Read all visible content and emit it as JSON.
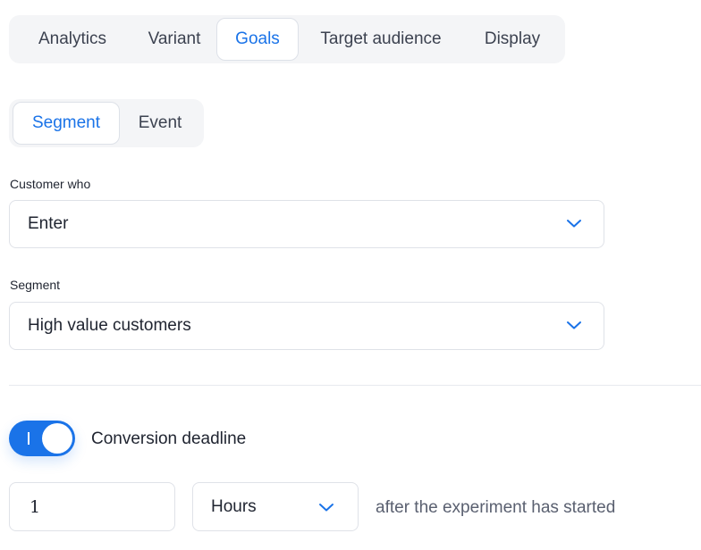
{
  "tabs": {
    "items": [
      {
        "label": "Analytics"
      },
      {
        "label": "Variant"
      },
      {
        "label": "Goals"
      },
      {
        "label": "Target audience"
      },
      {
        "label": "Display"
      }
    ],
    "active": "Goals"
  },
  "goal_type": {
    "options": [
      {
        "label": "Segment"
      },
      {
        "label": "Event"
      }
    ],
    "active": "Segment"
  },
  "customer_who": {
    "label": "Customer who",
    "value": "Enter"
  },
  "segment": {
    "label": "Segment",
    "value": "High value customers"
  },
  "conversion": {
    "toggle_on": true,
    "label": "Conversion deadline",
    "amount": "1",
    "unit": "Hours",
    "suffix": "after the experiment has started"
  },
  "colors": {
    "accent": "#1a73e8",
    "tab_bg": "#f4f5f7",
    "border": "#dfe2e8"
  },
  "icons": {
    "dropdown": "chevron-down-icon"
  }
}
